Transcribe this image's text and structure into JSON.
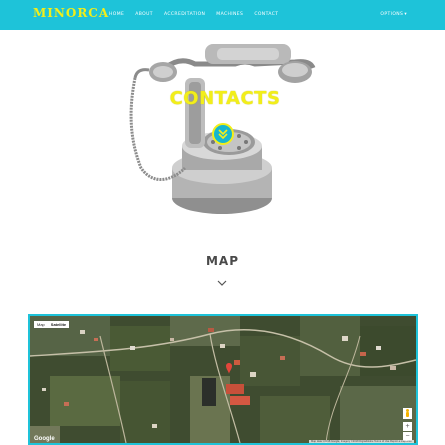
{
  "brand": {
    "logo": "MINORCA"
  },
  "nav": {
    "links": [
      "HOME",
      "ABOUT",
      "ACCREDITATION",
      "MACHINES",
      "CONTACT"
    ],
    "options_label": "OPTIONS",
    "options_caret": "▾"
  },
  "hero": {
    "title": "CONTACTS"
  },
  "map_section": {
    "heading": "MAP",
    "map_type": [
      "Map",
      "Satellite"
    ],
    "zoom_in": "+",
    "zoom_out": "−",
    "google_logo": "Google",
    "attribution": "Map data ©2018 Google, Imagery ©2018 DigitalGlobe  Terms of Use  Report a map error"
  },
  "colors": {
    "navbar": "#1ec3d9",
    "logo": "#f2ee1a",
    "title": "#f2ee1a",
    "heading": "#4a4a4a"
  }
}
